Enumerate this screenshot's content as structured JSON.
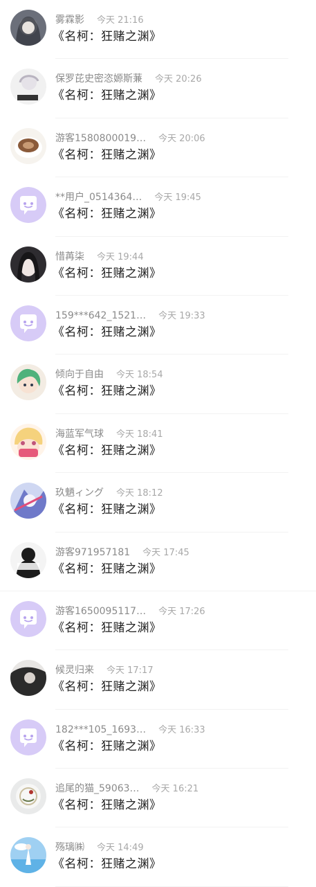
{
  "colors": {
    "default_avatar_bg": "#d7cbf7",
    "default_avatar_bubble": "#ffffff",
    "default_avatar_eyes": "#b7a3ee",
    "name_text": "#8a8a8a",
    "time_text": "#a8a8a8",
    "message_text": "#222222"
  },
  "comments": [
    {
      "name": "雾霖影",
      "time": "今天 21:16",
      "message": "《名柯：狂赌之渊》",
      "avatar": "user-photo"
    },
    {
      "name": "保罗芘史密恣嫄斯蒹",
      "time": "今天 20:26",
      "message": "《名柯：狂赌之渊》",
      "avatar": "user-photo"
    },
    {
      "name": "游客1580800019…",
      "time": "今天 20:06",
      "message": "《名柯：狂赌之渊》",
      "avatar": "user-photo"
    },
    {
      "name": "**用户_0514364…",
      "time": "今天 19:45",
      "message": "《名柯：狂赌之渊》",
      "avatar": "default-chat-icon"
    },
    {
      "name": "惜苒柒",
      "time": "今天 19:44",
      "message": "《名柯：狂赌之渊》",
      "avatar": "user-photo"
    },
    {
      "name": "159***642_1521…",
      "time": "今天 19:33",
      "message": "《名柯：狂赌之渊》",
      "avatar": "default-chat-icon"
    },
    {
      "name": "倾向于自由",
      "time": "今天 18:54",
      "message": "《名柯：狂赌之渊》",
      "avatar": "user-photo"
    },
    {
      "name": "海蓝军气球",
      "time": "今天 18:41",
      "message": "《名柯：狂赌之渊》",
      "avatar": "user-photo"
    },
    {
      "name": "玖魉ィング",
      "time": "今天 18:12",
      "message": "《名柯：狂赌之渊》",
      "avatar": "user-photo"
    },
    {
      "name": "游客971957181",
      "time": "今天 17:45",
      "message": "《名柯：狂赌之渊》",
      "avatar": "user-photo"
    },
    {
      "name": "游客1650095117…",
      "time": "今天 17:26",
      "message": "《名柯：狂赌之渊》",
      "avatar": "default-chat-icon"
    },
    {
      "name": "候灵归来",
      "time": "今天 17:17",
      "message": "《名柯：狂赌之渊》",
      "avatar": "user-photo"
    },
    {
      "name": "182***105_1693…",
      "time": "今天 16:33",
      "message": "《名柯：狂赌之渊》",
      "avatar": "default-chat-icon"
    },
    {
      "name": "追尾的猫_59063…",
      "time": "今天 16:21",
      "message": "《名柯：狂赌之渊》",
      "avatar": "user-photo"
    },
    {
      "name": "殇璃㈱",
      "time": "今天 14:49",
      "message": "《名柯：狂赌之渊》",
      "avatar": "user-photo"
    }
  ]
}
